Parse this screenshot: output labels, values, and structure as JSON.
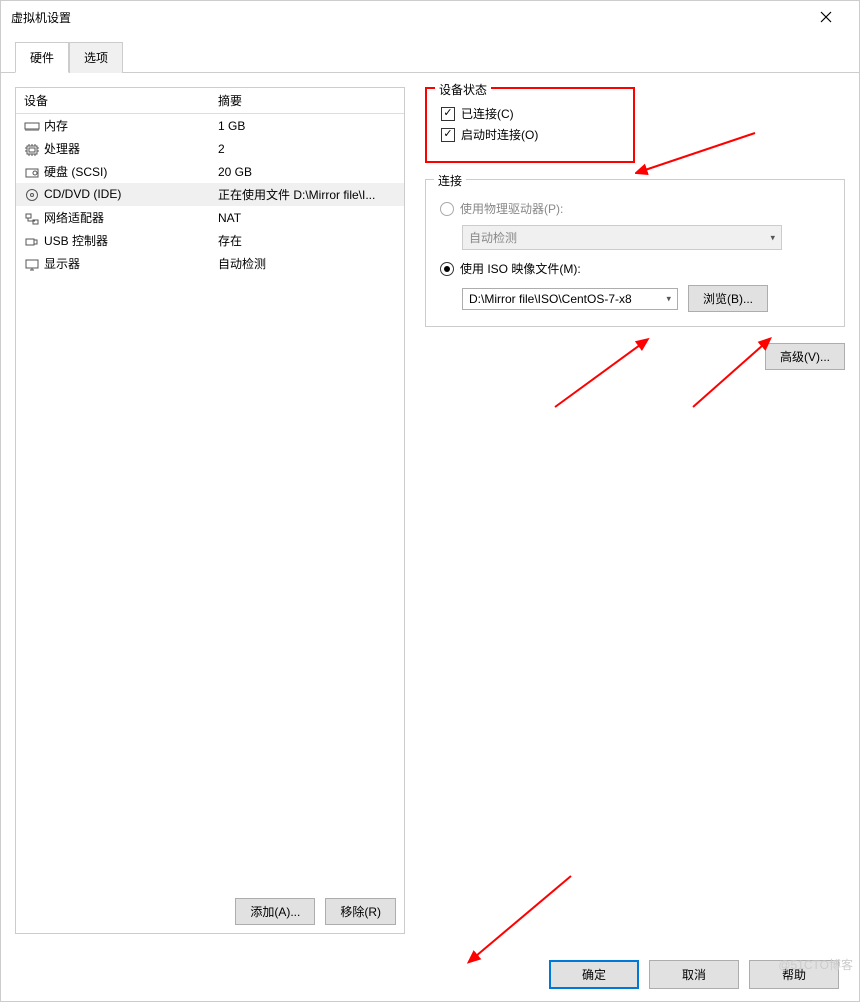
{
  "window": {
    "title": "虚拟机设置",
    "close_icon": "close-icon"
  },
  "tabs": {
    "hardware": "硬件",
    "options": "选项"
  },
  "table": {
    "header_device": "设备",
    "header_summary": "摘要",
    "rows": [
      {
        "name": "内存",
        "summary": "1 GB",
        "icon": "memory"
      },
      {
        "name": "处理器",
        "summary": "2",
        "icon": "cpu"
      },
      {
        "name": "硬盘 (SCSI)",
        "summary": "20 GB",
        "icon": "disk"
      },
      {
        "name": "CD/DVD (IDE)",
        "summary": "正在使用文件 D:\\Mirror file\\I...",
        "icon": "cd",
        "selected": true
      },
      {
        "name": "网络适配器",
        "summary": "NAT",
        "icon": "network"
      },
      {
        "name": "USB 控制器",
        "summary": "存在",
        "icon": "usb"
      },
      {
        "name": "显示器",
        "summary": "自动检测",
        "icon": "display"
      }
    ]
  },
  "left_buttons": {
    "add": "添加(A)...",
    "remove": "移除(R)"
  },
  "status_group": {
    "legend": "设备状态",
    "connected": "已连接(C)",
    "connect_at_poweron": "启动时连接(O)"
  },
  "connection_group": {
    "legend": "连接",
    "use_physical": "使用物理驱动器(P):",
    "physical_select": "自动检测",
    "use_iso": "使用 ISO 映像文件(M):",
    "iso_path": "D:\\Mirror file\\ISO\\CentOS-7-x8",
    "browse": "浏览(B)..."
  },
  "advanced_button": "高级(V)...",
  "footer": {
    "ok": "确定",
    "cancel": "取消",
    "help": "帮助"
  },
  "watermark": "@51CTO博客"
}
